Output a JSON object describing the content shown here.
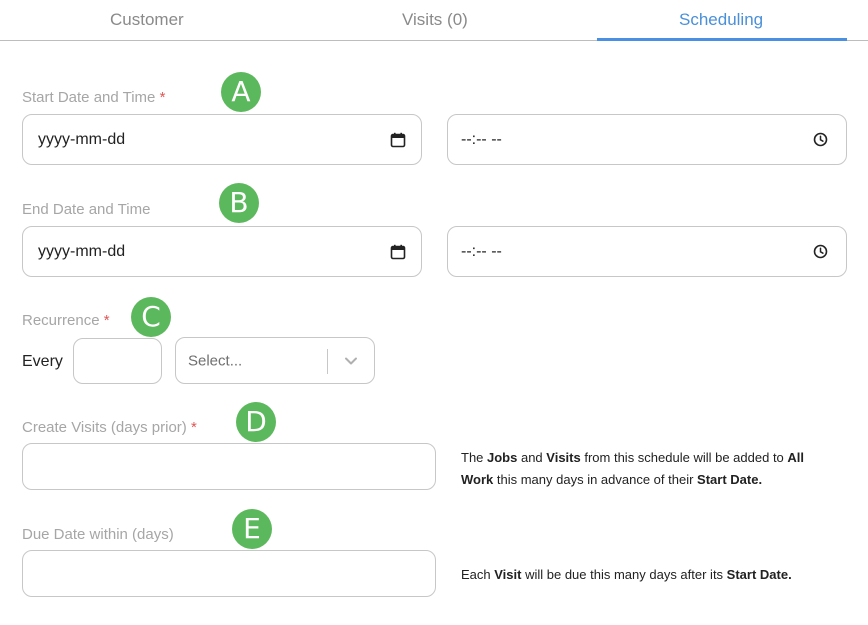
{
  "tabs": [
    {
      "label": "Customer",
      "active": false
    },
    {
      "label": "Visits (0)",
      "active": false
    },
    {
      "label": "Scheduling",
      "active": true
    }
  ],
  "start": {
    "label": "Start Date and Time",
    "required_mark": "*",
    "badge": "A",
    "date_placeholder": "yyyy-mm-dd",
    "time_placeholder": "--:-- --"
  },
  "end": {
    "label": "End Date and Time",
    "badge": "B",
    "date_placeholder": "yyyy-mm-dd",
    "time_placeholder": "--:-- --"
  },
  "recurrence": {
    "label": "Recurrence",
    "required_mark": "*",
    "badge": "C",
    "every_label": "Every",
    "every_value": "",
    "select_placeholder": "Select..."
  },
  "create_visits": {
    "label": "Create Visits (days prior)",
    "required_mark": "*",
    "badge": "D",
    "value": "",
    "hint": {
      "t1": "The ",
      "b1": "Jobs",
      "t2": " and ",
      "b2": "Visits",
      "t3": " from this schedule will be added to ",
      "b3": "All Work",
      "t4": " this many days in advance of their ",
      "b4": "Start Date."
    }
  },
  "due_date": {
    "label": "Due Date within (days)",
    "badge": "E",
    "value": "",
    "hint": {
      "t1": "Each ",
      "b1": "Visit",
      "t2": " will be due this many days after its ",
      "b2": "Start Date."
    }
  },
  "colors": {
    "accent": "#4a90e2",
    "badge": "#5cb85c",
    "required": "#e25555",
    "label": "#a6a6a6"
  }
}
